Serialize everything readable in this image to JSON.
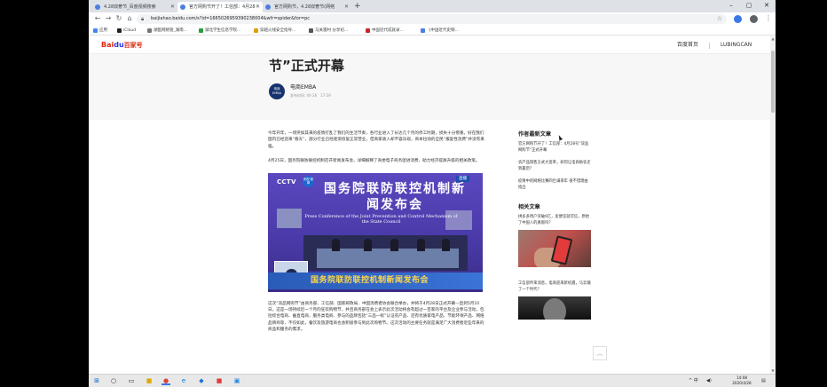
{
  "browser": {
    "tabs": [
      {
        "label": "4.28双奢节_百度视频搜索"
      },
      {
        "label": "官方网购节开了！工信部：4月28"
      },
      {
        "label": "官方网购节，4.28双奢节(网络"
      }
    ],
    "new_tab": "+",
    "window_controls": {
      "minimize": "–",
      "maximize": "▢",
      "close": "✕"
    },
    "url": "baijiahao.baidu.com/s?id=1665026959390238004&wfr=spider&for=pc",
    "bookmarks": [
      "应用",
      "iCloud",
      "湖医网络管_湖南...",
      "湖北学生信息学院...",
      "穿越火线安全指导...",
      "马关雷村 分享初...",
      "中国近代成就录...",
      "《中国近代史纲..."
    ]
  },
  "site": {
    "logo_primary": "Bai",
    "logo_paw": "du",
    "logo_suffix": "百家号",
    "nav": {
      "home": "百度首页",
      "user": "LUBINGCAN"
    }
  },
  "article": {
    "title": "节”正式开幕",
    "author": "电商EMBA",
    "avatar_text": "电商 EMBA",
    "meta": "发布时间: 04-26　17:39",
    "paragraphs": [
      "今年开年，一场突如其来的疫情打乱了我们的生活节奏，各行业进入了长达几个月的停工时期，损失十分惨重。好在我们国内已经迎来“春天”，部分行业已经逐渐恢复正常营业，但商家收入却不容乐观，商本拉动的全民“报复性消费”并没有来临。",
      "4月25日，国务院联防联控机制召开新闻发布会，详细解释了商委电子商务促进消费、助力经济提质升级的相关政策。",
      "这次“双品网购节”由商务部、工信部、国家邮政局、中国消费者协会联合举办，并将于4月28日正式开幕—直到5月10日。这是一场持续近一个月的狂欢购物节，并且商务部在会上表示此次活动将会有超过一百家的平台及企业参与活动，包括综合电商、垂直电商、服务类电商、参与的品牌包括“三品一标”认证农产品、还有优质家电产品、节能环保产品、网络品牌商等、不仅如此，餐饮及旅游电商也会积极参与到此次购物节。这次活动的主要任务就是满足广大消费者近些年来的商品和服务的需求。"
    ],
    "image": {
      "cctv": "CCTV",
      "badge": "央视 新闻",
      "tag": "直播",
      "cn_title": "国务院联防联控机制新闻发布会",
      "en_title": "Press Conference of the Joint Prevention and Control Mechanism of the State Council",
      "caption": "国务院联防联控机制新闻发布会"
    }
  },
  "sidebar": {
    "latest_heading": "作者最新文章",
    "latest": [
      "官方网购节开了！工信部：4月28号“双品网购节”正式开幕",
      "农产品销售方式大变革，如何让电商助农走到最后？",
      "疫情中的网络比赛四巨满来年 很不错理由指出"
    ],
    "related_heading": "相关文章",
    "related": [
      "拼多多用户突破6亿，卖便宜就可信，原始了中国人的真假吗？",
      "工信部传来消息，电商迎来新机遇，马云输了一个时代？"
    ]
  },
  "taskbar": {
    "start": "⊞",
    "search": "○",
    "tray_text": "^ 中",
    "clock_time": "14:08",
    "clock_date": "2020/4/28"
  },
  "colors": {
    "baidu_red": "#de2910",
    "baidu_blue": "#2932e1",
    "caption_yellow": "#ffd84a"
  }
}
